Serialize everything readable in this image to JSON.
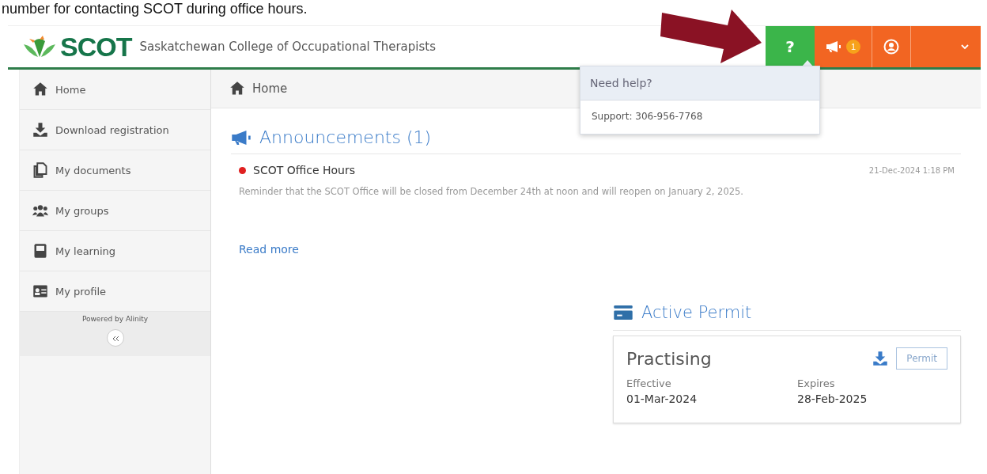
{
  "caption": "number for contacting SCOT during office hours.",
  "header": {
    "logo": "SCOT",
    "org_name": "Saskatchewan College of Occupational Therapists",
    "help_label": "?",
    "notification_count": "1"
  },
  "help_popup": {
    "title": "Need help?",
    "support": "Support: 306-956-7768"
  },
  "sidebar": {
    "items": [
      {
        "label": "Home"
      },
      {
        "label": "Download registration"
      },
      {
        "label": "My documents"
      },
      {
        "label": "My groups"
      },
      {
        "label": "My learning"
      },
      {
        "label": "My profile"
      }
    ],
    "footer": "Powered by Alinity"
  },
  "breadcrumb": "Home",
  "announcements": {
    "title": "Announcements (1)",
    "items": [
      {
        "title": "SCOT Office Hours",
        "color": "#e02020",
        "date": "21-Dec-2024 1:18 PM",
        "body": "Reminder that the SCOT Office will be closed from December 24th at noon and will reopen on January 2, 2025.",
        "link": "Read more"
      }
    ]
  },
  "permit": {
    "title": "Active Permit",
    "status": "Practising",
    "button": "Permit",
    "fields": [
      {
        "label": "Effective",
        "value": "01-Mar-2024"
      },
      {
        "label": "Expires",
        "value": "28-Feb-2025"
      }
    ]
  }
}
